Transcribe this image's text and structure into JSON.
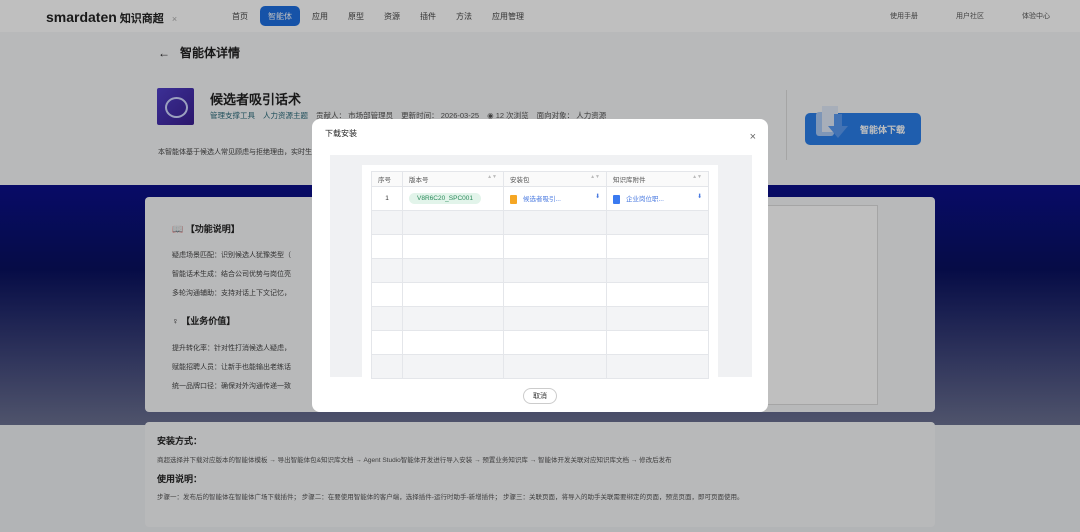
{
  "nav": {
    "logo": "smardaten",
    "logo_suffix": "知识商超",
    "close": "×",
    "items": [
      {
        "label": "首页"
      },
      {
        "label": "智能体",
        "active": true
      },
      {
        "label": "应用"
      },
      {
        "label": "原型"
      },
      {
        "label": "资源"
      },
      {
        "label": "插件"
      },
      {
        "label": "方法"
      },
      {
        "label": "应用管理"
      }
    ],
    "right": [
      "使用手册",
      "用户社区",
      "体验中心"
    ]
  },
  "page": {
    "back_title": "智能体详情",
    "agent_title": "候选者吸引话术",
    "tags": [
      "管理支撑工具",
      "人力资源主题"
    ],
    "contributor_label": "贡献人：",
    "contributor": "市场部管理员",
    "updated_label": "更新时间：",
    "updated": "2026-03-25",
    "views": "12",
    "views_suffix": "次浏览",
    "audience_label": "面向对象：",
    "audience": "人力资源",
    "desc": "本智能体基于候选人常见顾虑与拒绝理由，实时生",
    "download_button": "智能体下载"
  },
  "features": {
    "title": "【功能说明】",
    "items": [
      "疑虑场景匹配：识别候选人犹豫类型（",
      "智能话术生成：结合公司优势与岗位亮",
      "多轮沟通辅助：支持对话上下文记忆，"
    ]
  },
  "value": {
    "title": "【业务价值】",
    "items": [
      "提升转化率：针对性打消候选人疑虑，",
      "赋能招聘人员：让新手也能输出老练话",
      "统一品牌口径：确保对外沟通传递一致"
    ]
  },
  "install": {
    "title": "安装方式：",
    "text": "商超选择并下载对应版本的智能体模板 → 导出智能体包&知识库文档 → Agent Studio智能体开发进行导入安装 → 预置业务知识库 → 智能体开发关联对应知识库文档 → 修改后发布",
    "usage_title": "使用说明：",
    "usage": "步骤一：发布后的智能体在智能体广场下载插件；  步骤二：在要使用智能体的客户端，选择插件-运行时助手-新增插件；  步骤三：关联页面，将导入的助手关联需要绑定的页面，预览页面，即可页面使用。"
  },
  "modal": {
    "title": "下载安装",
    "close": "×",
    "columns": [
      "序号",
      "版本号",
      "安装包",
      "知识库附件"
    ],
    "rows": [
      {
        "index": "1",
        "version": "V8R6C20_SPC001",
        "package": "候选者吸引...",
        "attachment": "企业岗位职..."
      }
    ],
    "cancel": "取消"
  },
  "colors": {
    "primary": "#1e6fe0",
    "version_tag": "#2a8a5a",
    "package_icon": "#f5a623",
    "doc_icon": "#3a7af0"
  }
}
